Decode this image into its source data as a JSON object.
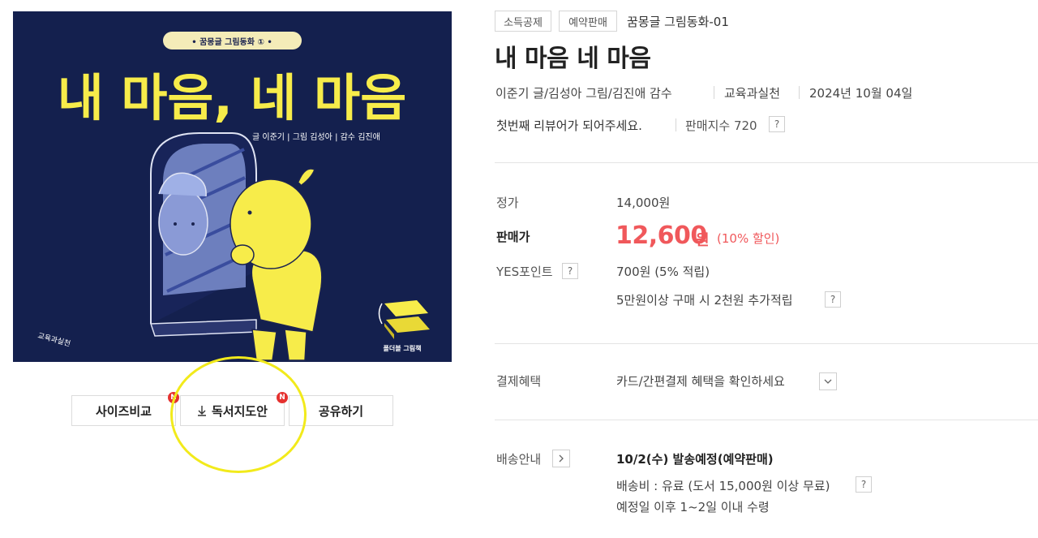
{
  "cover": {
    "series_banner": "• 꿈몽글 그림동화 ① •",
    "main_title": "내 마음, 네 마음",
    "credits": "글 이준기 | 그림 김성아 | 감수 김진애",
    "publisher_logo": "교육과실천",
    "foldable_label": "폴더블 그림책"
  },
  "actions": {
    "size_compare": "사이즈비교",
    "reading_guide": "독서지도안",
    "share": "공유하기",
    "new_badge": "N"
  },
  "product": {
    "tags": [
      "소득공제",
      "예약판매"
    ],
    "series": "꿈몽글 그림동화-01",
    "title": "내 마음 네 마음",
    "authors": "이준기 글/김성아 그림/김진애 감수",
    "publisher": "교육과실천",
    "pub_date": "2024년 10월 04일",
    "review_prompt": "첫번째 리뷰어가 되어주세요.",
    "sales_index": "판매지수 720"
  },
  "pricing": {
    "list_label": "정가",
    "list_price": "14,000원",
    "sale_label": "판매가",
    "sale_price": "12,600",
    "sale_unit": "원",
    "discount": "(10% 할인)",
    "points_label": "YES포인트",
    "points_value": "700원 (5% 적립)",
    "extra_points": "5만원이상 구매 시 2천원 추가적립"
  },
  "payment": {
    "label": "결제혜택",
    "value": "카드/간편결제 혜택을 확인하세요"
  },
  "shipping": {
    "label": "배송안내",
    "date": "10/2(수) 발송예정(예약판매)",
    "fee": "배송비 : 유료 (도서 15,000원 이상 무료)",
    "arrival": "예정일 이후 1~2일 이내 수령"
  },
  "help_mark": "?",
  "colors": {
    "cover_bg": "#14204e",
    "cover_yellow": "#f7ec4a",
    "sale_red": "#f0585b",
    "highlight": "#f2ea1b",
    "badge_red": "#e5312f"
  }
}
